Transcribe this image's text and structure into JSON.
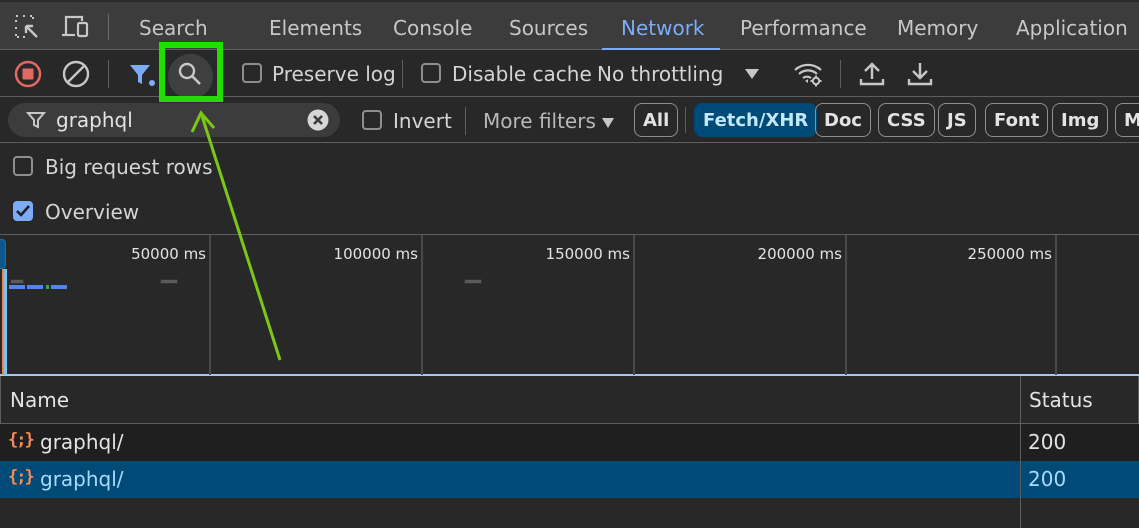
{
  "tabs": {
    "items": [
      {
        "label": "Search",
        "active": false
      },
      {
        "label": "Elements",
        "active": false
      },
      {
        "label": "Console",
        "active": false
      },
      {
        "label": "Sources",
        "active": false
      },
      {
        "label": "Network",
        "active": true
      },
      {
        "label": "Performance",
        "active": false
      },
      {
        "label": "Memory",
        "active": false
      },
      {
        "label": "Application",
        "active": false
      }
    ],
    "icons": [
      "inspect-element-icon",
      "device-toolbar-icon"
    ]
  },
  "toolbar": {
    "record_icon": "stop-recording-icon",
    "clear_icon": "clear-icon",
    "filter_icon": "filter-icon",
    "search_icon": "search-icon",
    "preserve_log": {
      "label": "Preserve log",
      "checked": false
    },
    "disable_cache": {
      "label": "Disable cache",
      "checked": false
    },
    "throttling": {
      "value": "No throttling"
    },
    "network_conditions_icon": "network-conditions-icon",
    "import_icon": "upload-icon",
    "export_icon": "download-icon"
  },
  "filter": {
    "value": "graphql",
    "invert": {
      "label": "Invert",
      "checked": false
    },
    "more_filters": "More filters",
    "chips": [
      {
        "label": "All",
        "active": false
      },
      {
        "label": "Fetch/XHR",
        "active": true
      },
      {
        "label": "Doc",
        "active": false
      },
      {
        "label": "CSS",
        "active": false
      },
      {
        "label": "JS",
        "active": false
      },
      {
        "label": "Font",
        "active": false
      },
      {
        "label": "Img",
        "active": false
      },
      {
        "label": "M",
        "active": false
      }
    ]
  },
  "options": {
    "big_request_rows": {
      "label": "Big request rows",
      "checked": false
    },
    "overview": {
      "label": "Overview",
      "checked": true
    }
  },
  "overview": {
    "ticks": [
      "50000 ms",
      "100000 ms",
      "150000 ms",
      "200000 ms",
      "250000 ms"
    ]
  },
  "table": {
    "columns": [
      "Name",
      "Status"
    ],
    "rows": [
      {
        "name": "graphql/",
        "status": "200",
        "selected": false
      },
      {
        "name": "graphql/",
        "status": "200",
        "selected": true
      }
    ]
  },
  "colors": {
    "accent": "#7cacf8",
    "selected_row": "#004a77",
    "highlight": "#22dd00",
    "arrow": "#7cc614",
    "record": "#e46962"
  }
}
